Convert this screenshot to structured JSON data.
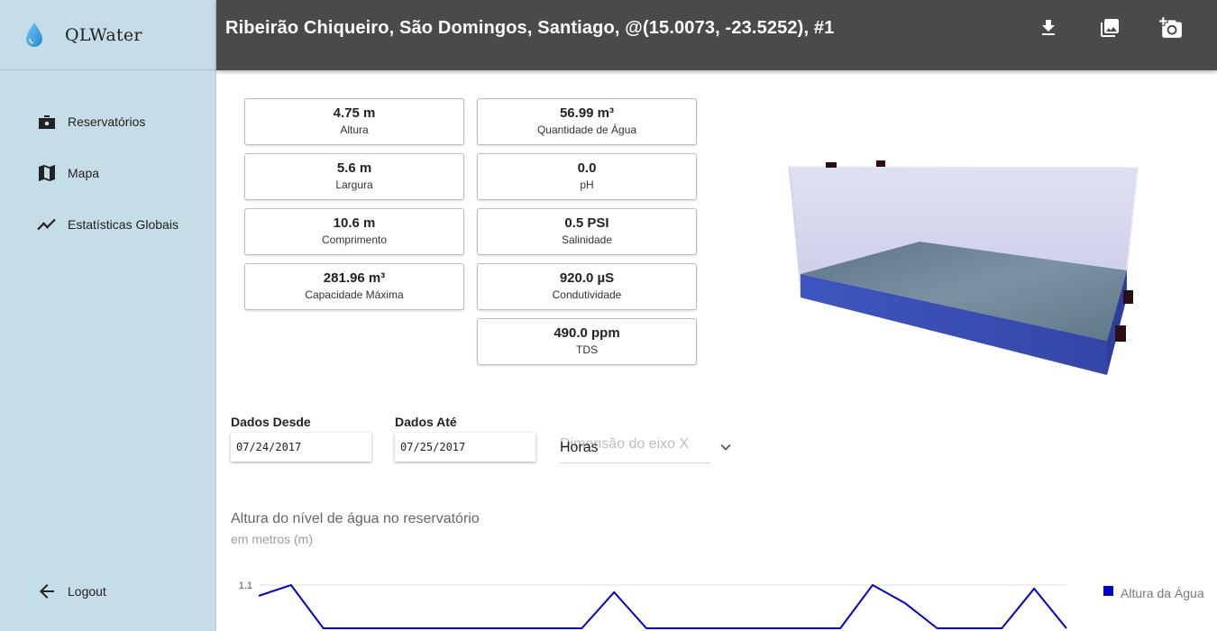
{
  "app": {
    "name": "QLWater"
  },
  "sidebar": {
    "items": [
      {
        "label": "Reservatórios",
        "icon": "reservoir-icon"
      },
      {
        "label": "Mapa",
        "icon": "map-icon"
      },
      {
        "label": "Estatísticas Globais",
        "icon": "trending-up-icon"
      }
    ],
    "logout": {
      "label": "Logout",
      "icon": "arrow-back-icon"
    }
  },
  "topbar": {
    "title": "Ribeirão Chiqueiro, São Domingos, Santiago, @(15.0073, -23.5252), #1",
    "actions": [
      "download-icon",
      "image-icon",
      "add-photo-icon"
    ]
  },
  "metrics": {
    "left": [
      {
        "value": "4.75 m",
        "caption": "Altura"
      },
      {
        "value": "5.6 m",
        "caption": "Largura"
      },
      {
        "value": "10.6 m",
        "caption": "Comprimento"
      },
      {
        "value": "281.96 m³",
        "caption": "Capacidade Máxima"
      }
    ],
    "right": [
      {
        "value": "56.99 m³",
        "caption": "Quantidade de Água"
      },
      {
        "value": "0.0",
        "caption": "pH"
      },
      {
        "value": "0.5 PSI",
        "caption": "Salinidade"
      },
      {
        "value": "920.0 µS",
        "caption": "Condutividade"
      },
      {
        "value": "490.0 ppm",
        "caption": "TDS"
      }
    ]
  },
  "filters": {
    "from_label": "Dados Desde",
    "from_value": "07/24/2017",
    "to_label": "Dados Até",
    "to_value": "07/25/2017",
    "axis_placeholder": "Dimensão do eixo X",
    "axis_value": "Horas"
  },
  "colors": {
    "sidebar": "#c5dde6",
    "topbar": "#4a4a4a",
    "series": "#0000cc",
    "water": "#3b4fb0"
  },
  "chart_data": {
    "type": "line",
    "title": "Altura do nível de água no reservatório",
    "subtitle": "em metros (m)",
    "y_tick_labels": [
      "1.1"
    ],
    "series": [
      {
        "name": "Altura da Água",
        "points": [
          [
            0,
            1.07
          ],
          [
            1,
            1.1
          ],
          [
            2,
            0.98
          ],
          [
            10,
            0.98
          ],
          [
            11,
            1.08
          ],
          [
            12,
            0.98
          ],
          [
            18,
            0.98
          ],
          [
            19,
            1.1
          ],
          [
            20,
            1.05
          ],
          [
            21,
            0.98
          ],
          [
            23,
            0.98
          ],
          [
            24,
            1.09
          ],
          [
            25,
            0.98
          ]
        ]
      }
    ],
    "legend_position": "top-right"
  }
}
